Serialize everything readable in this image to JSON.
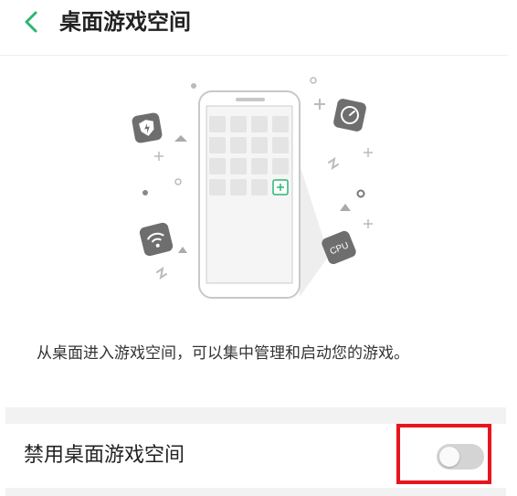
{
  "header": {
    "title": "桌面游戏空间",
    "back_icon": "chevron-left-icon",
    "accent_color": "#2bb673"
  },
  "illustration": {
    "icons": [
      "shield-lightning-icon",
      "gauge-icon",
      "wifi-icon",
      "cpu-icon",
      "add-icon"
    ],
    "cpu_label": "CPU"
  },
  "description": "从桌面进入游戏空间，可以集中管理和启动您的游戏。",
  "setting": {
    "label": "禁用桌面游戏空间",
    "enabled": false
  },
  "annotation": {
    "highlight_color": "#e8141c"
  }
}
